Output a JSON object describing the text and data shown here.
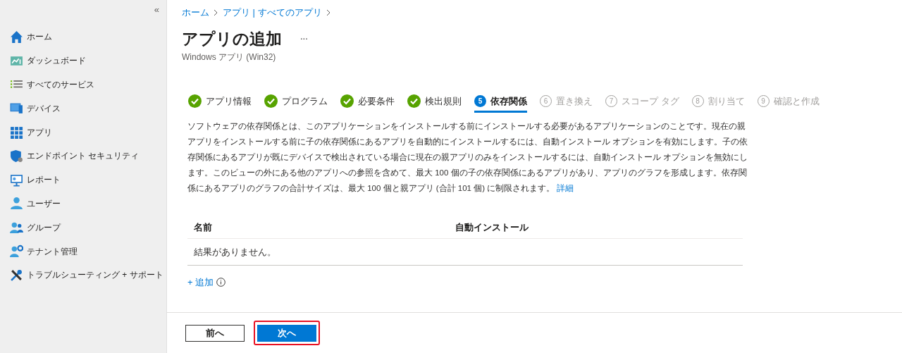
{
  "sidebar": {
    "collapse": "«",
    "items": [
      {
        "label": "ホーム"
      },
      {
        "label": "ダッシュボード"
      },
      {
        "label": "すべてのサービス"
      },
      {
        "label": "デバイス"
      },
      {
        "label": "アプリ"
      },
      {
        "label": "エンドポイント セキュリティ"
      },
      {
        "label": "レポート"
      },
      {
        "label": "ユーザー"
      },
      {
        "label": "グループ"
      },
      {
        "label": "テナント管理"
      },
      {
        "label": "トラブルシューティング + サポート"
      }
    ]
  },
  "breadcrumb": [
    "ホーム",
    "アプリ | すべてのアプリ"
  ],
  "title": "アプリの追加",
  "more": "...",
  "subtitle": "Windows アプリ (Win32)",
  "steps": [
    {
      "label": "アプリ情報",
      "kind": "done",
      "selected": false
    },
    {
      "label": "プログラム",
      "kind": "done",
      "selected": false
    },
    {
      "label": "必要条件",
      "kind": "done",
      "selected": false
    },
    {
      "label": "検出規則",
      "kind": "done",
      "selected": false
    },
    {
      "label": "依存関係",
      "kind": "current",
      "number": "5",
      "selected": true
    },
    {
      "label": "置き換え",
      "kind": "pending",
      "number": "6",
      "selected": false
    },
    {
      "label": "スコープ タグ",
      "kind": "pending",
      "number": "7",
      "selected": false
    },
    {
      "label": "割り当て",
      "kind": "pending",
      "number": "8",
      "selected": false
    },
    {
      "label": "確認と作成",
      "kind": "pending",
      "number": "9",
      "selected": false
    }
  ],
  "description": "ソフトウェアの依存関係とは、このアプリケーションをインストールする前にインストールする必要があるアプリケーションのことです。現在の親アプリをインストールする前に子の依存関係にあるアプリを自動的にインストールするには、自動インストール オプションを有効にします。子の依存関係にあるアプリが既にデバイスで検出されている場合に現在の親アプリのみをインストールするには、自動インストール オプションを無効にします。このビューの外にある他のアプリへの参照を含めて、最大 100 個の子の依存関係にあるアプリがあり、アプリのグラフを形成します。依存関係にあるアプリのグラフの合計サイズは、最大 100 個と親アプリ (合計 101 個) に制限されます。",
  "description_link": "詳細",
  "table": {
    "columns": [
      "名前",
      "自動インストール"
    ],
    "empty": "結果がありません。"
  },
  "add": "+ 追加",
  "buttons": [
    {
      "label": "前へ",
      "kind": "secondary",
      "highlighted": false
    },
    {
      "label": "次へ",
      "kind": "primary",
      "highlighted": true
    }
  ]
}
